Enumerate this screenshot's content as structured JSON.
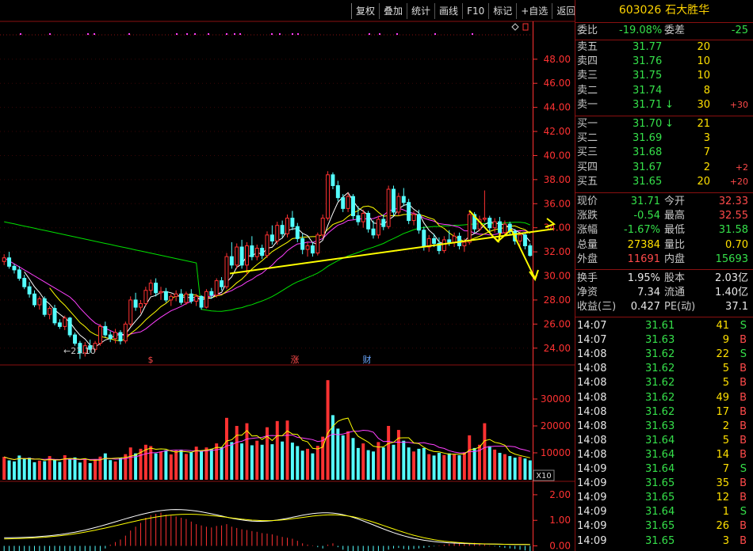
{
  "toolbar": {
    "buttons": [
      "复权",
      "叠加",
      "统计",
      "画线",
      "F10",
      "标记",
      "+自选",
      "返回"
    ]
  },
  "stock": {
    "code": "603026",
    "name": "石大胜华"
  },
  "ratio": {
    "wb_label": "委比",
    "wb_value": "-19.08%",
    "wc_label": "委差",
    "wc_value": "-25"
  },
  "asks": [
    {
      "label": "卖五",
      "price": "31.77",
      "vol": "20",
      "chg": ""
    },
    {
      "label": "卖四",
      "price": "31.76",
      "vol": "10",
      "chg": ""
    },
    {
      "label": "卖三",
      "price": "31.75",
      "vol": "10",
      "chg": ""
    },
    {
      "label": "卖二",
      "price": "31.74",
      "vol": "8",
      "chg": ""
    },
    {
      "label": "卖一",
      "price": "31.71",
      "vol": "30",
      "chg": "+30",
      "arrow": "↓"
    }
  ],
  "bids": [
    {
      "label": "买一",
      "price": "31.70",
      "vol": "21",
      "chg": "",
      "arrow": "↓"
    },
    {
      "label": "买二",
      "price": "31.69",
      "vol": "3",
      "chg": ""
    },
    {
      "label": "买三",
      "price": "31.68",
      "vol": "7",
      "chg": ""
    },
    {
      "label": "买四",
      "price": "31.67",
      "vol": "2",
      "chg": "+2"
    },
    {
      "label": "买五",
      "price": "31.65",
      "vol": "20",
      "chg": "+20"
    }
  ],
  "quote": [
    {
      "l1": "现价",
      "v1": "31.71",
      "c1": "green",
      "l2": "今开",
      "v2": "32.33",
      "c2": "red"
    },
    {
      "l1": "涨跌",
      "v1": "-0.54",
      "c1": "green",
      "l2": "最高",
      "v2": "32.55",
      "c2": "red"
    },
    {
      "l1": "涨幅",
      "v1": "-1.67%",
      "c1": "green",
      "l2": "最低",
      "v2": "31.58",
      "c2": "green"
    },
    {
      "l1": "总量",
      "v1": "27384",
      "c1": "yellow",
      "l2": "量比",
      "v2": "0.70",
      "c2": "yellow"
    },
    {
      "l1": "外盘",
      "v1": "11691",
      "c1": "red",
      "l2": "内盘",
      "v2": "15693",
      "c2": "green"
    }
  ],
  "finance": [
    {
      "l1": "换手",
      "v1": "1.95%",
      "l2": "股本",
      "v2": "2.03亿"
    },
    {
      "l1": "净资",
      "v1": "7.34",
      "l2": "流通",
      "v2": "1.40亿"
    },
    {
      "l1": "收益(三)",
      "v1": "0.427",
      "l2": "PE(动)",
      "v2": "37.1"
    }
  ],
  "ticks": [
    {
      "time": "14:07",
      "price": "31.61",
      "vol": "41",
      "side": "S"
    },
    {
      "time": "14:07",
      "price": "31.63",
      "vol": "9",
      "side": "B"
    },
    {
      "time": "14:08",
      "price": "31.62",
      "vol": "22",
      "side": "S"
    },
    {
      "time": "14:08",
      "price": "31.62",
      "vol": "5",
      "side": "B"
    },
    {
      "time": "14:08",
      "price": "31.62",
      "vol": "5",
      "side": "B"
    },
    {
      "time": "14:08",
      "price": "31.62",
      "vol": "49",
      "side": "B"
    },
    {
      "time": "14:08",
      "price": "31.62",
      "vol": "17",
      "side": "B"
    },
    {
      "time": "14:08",
      "price": "31.63",
      "vol": "2",
      "side": "B"
    },
    {
      "time": "14:08",
      "price": "31.64",
      "vol": "5",
      "side": "B"
    },
    {
      "time": "14:08",
      "price": "31.64",
      "vol": "14",
      "side": "B"
    },
    {
      "time": "14:09",
      "price": "31.64",
      "vol": "7",
      "side": "S"
    },
    {
      "time": "14:09",
      "price": "31.65",
      "vol": "35",
      "side": "B"
    },
    {
      "time": "14:09",
      "price": "31.65",
      "vol": "12",
      "side": "B"
    },
    {
      "time": "14:09",
      "price": "31.64",
      "vol": "1",
      "side": "S"
    },
    {
      "time": "14:09",
      "price": "31.65",
      "vol": "26",
      "side": "B"
    },
    {
      "time": "14:09",
      "price": "31.65",
      "vol": "3",
      "side": "B"
    }
  ],
  "chart": {
    "price_ticks": [
      "48.00",
      "46.00",
      "44.00",
      "42.00",
      "40.00",
      "38.00",
      "36.00",
      "34.00",
      "32.00",
      "30.00",
      "28.00",
      "26.00",
      "24.00"
    ],
    "low_label": "←23.10",
    "markers": [
      "$",
      "涨",
      "财"
    ],
    "volume_ticks": [
      "30000",
      "20000",
      "10000"
    ],
    "volume_unit": "X10",
    "macd_ticks": [
      "2.00",
      "1.00",
      "0.00"
    ],
    "colors": {
      "up": "#ff3232",
      "down": "#54ffff",
      "ma5": "#ffffff",
      "ma10": "#ffff00",
      "ma20": "#ff40ff",
      "ma60": "#00e000",
      "grid": "#8a1010",
      "axis": "#ff3232"
    }
  },
  "chart_data": {
    "type": "candlestick",
    "values": [
      [
        31.2,
        31.8,
        30.9,
        31.5
      ],
      [
        31.5,
        32.0,
        30.6,
        30.8
      ],
      [
        30.8,
        31.0,
        30.2,
        30.5
      ],
      [
        30.5,
        30.8,
        29.6,
        29.8
      ],
      [
        29.8,
        30.1,
        28.9,
        29.1
      ],
      [
        29.1,
        29.5,
        28.2,
        28.5
      ],
      [
        28.5,
        28.8,
        27.4,
        27.6
      ],
      [
        27.6,
        28.3,
        27.2,
        28.1
      ],
      [
        28.1,
        28.3,
        26.6,
        26.8
      ],
      [
        26.8,
        27.5,
        26.4,
        27.3
      ],
      [
        27.3,
        27.6,
        25.9,
        26.1
      ],
      [
        26.1,
        26.4,
        25.6,
        25.8
      ],
      [
        25.8,
        26.7,
        25.5,
        26.5
      ],
      [
        26.5,
        26.6,
        24.9,
        25.1
      ],
      [
        25.1,
        25.3,
        24.2,
        24.4
      ],
      [
        24.4,
        24.6,
        23.1,
        23.6
      ],
      [
        23.6,
        24.5,
        23.3,
        24.2
      ],
      [
        24.2,
        24.7,
        23.6,
        23.9
      ],
      [
        23.9,
        24.6,
        23.7,
        24.4
      ],
      [
        24.4,
        26.0,
        24.2,
        25.8
      ],
      [
        25.8,
        26.2,
        24.9,
        25.1
      ],
      [
        25.1,
        25.4,
        24.5,
        24.8
      ],
      [
        24.8,
        25.6,
        24.4,
        25.3
      ],
      [
        25.3,
        25.5,
        24.3,
        24.6
      ],
      [
        24.6,
        26.2,
        24.4,
        26.0
      ],
      [
        26.0,
        28.3,
        25.8,
        28.0
      ],
      [
        28.0,
        28.6,
        27.1,
        27.4
      ],
      [
        27.4,
        28.0,
        26.9,
        27.7
      ],
      [
        27.7,
        29.1,
        27.5,
        28.8
      ],
      [
        28.8,
        29.7,
        28.4,
        29.4
      ],
      [
        29.4,
        29.8,
        28.3,
        28.6
      ],
      [
        28.6,
        29.1,
        28.0,
        28.7
      ],
      [
        28.7,
        29.0,
        27.8,
        28.0
      ],
      [
        28.0,
        28.5,
        27.5,
        28.3
      ],
      [
        28.3,
        28.8,
        27.9,
        28.5
      ],
      [
        28.5,
        28.9,
        27.6,
        27.8
      ],
      [
        27.8,
        28.7,
        27.6,
        28.5
      ],
      [
        28.5,
        28.9,
        27.7,
        27.9
      ],
      [
        27.9,
        28.5,
        27.5,
        28.3
      ],
      [
        28.3,
        28.4,
        27.2,
        27.4
      ],
      [
        27.4,
        28.9,
        27.3,
        28.7
      ],
      [
        28.7,
        29.0,
        28.1,
        28.4
      ],
      [
        28.4,
        29.8,
        28.2,
        29.6
      ],
      [
        29.6,
        29.9,
        28.8,
        29.1
      ],
      [
        29.1,
        31.9,
        28.9,
        31.6
      ],
      [
        31.6,
        32.8,
        30.6,
        30.9
      ],
      [
        30.9,
        32.7,
        30.6,
        32.4
      ],
      [
        32.4,
        33.0,
        30.6,
        30.9
      ],
      [
        30.9,
        32.8,
        30.1,
        32.5
      ],
      [
        32.5,
        33.3,
        31.3,
        31.6
      ],
      [
        31.6,
        32.6,
        31.3,
        32.3
      ],
      [
        32.3,
        32.6,
        31.4,
        31.7
      ],
      [
        31.7,
        33.7,
        31.5,
        33.4
      ],
      [
        33.4,
        34.2,
        32.6,
        32.9
      ],
      [
        32.9,
        34.5,
        32.6,
        34.2
      ],
      [
        34.2,
        34.6,
        33.2,
        33.5
      ],
      [
        33.5,
        35.1,
        33.2,
        34.8
      ],
      [
        34.8,
        35.4,
        33.8,
        34.1
      ],
      [
        34.1,
        34.4,
        32.8,
        33.1
      ],
      [
        33.1,
        33.5,
        31.8,
        32.2
      ],
      [
        32.2,
        32.8,
        31.6,
        32.5
      ],
      [
        32.5,
        32.8,
        31.6,
        31.9
      ],
      [
        31.9,
        33.6,
        31.7,
        33.4
      ],
      [
        33.4,
        35.1,
        33.1,
        34.8
      ],
      [
        34.8,
        38.7,
        34.6,
        38.4
      ],
      [
        38.4,
        38.6,
        37.2,
        37.5
      ],
      [
        37.5,
        37.9,
        36.2,
        36.5
      ],
      [
        36.5,
        36.8,
        35.3,
        35.6
      ],
      [
        35.6,
        36.9,
        35.3,
        36.6
      ],
      [
        36.6,
        36.8,
        34.7,
        35.0
      ],
      [
        35.0,
        35.8,
        34.2,
        34.5
      ],
      [
        34.5,
        35.5,
        34.0,
        35.2
      ],
      [
        35.2,
        35.4,
        33.6,
        33.9
      ],
      [
        33.9,
        34.6,
        33.1,
        33.4
      ],
      [
        33.4,
        35.0,
        33.1,
        34.7
      ],
      [
        34.7,
        35.1,
        33.8,
        34.1
      ],
      [
        34.1,
        37.5,
        33.9,
        37.2
      ],
      [
        37.2,
        37.5,
        35.0,
        35.3
      ],
      [
        35.3,
        36.9,
        35.0,
        36.6
      ],
      [
        36.6,
        37.3,
        35.8,
        36.1
      ],
      [
        36.1,
        36.4,
        34.3,
        34.6
      ],
      [
        34.6,
        35.4,
        34.2,
        35.1
      ],
      [
        35.1,
        35.5,
        33.5,
        33.8
      ],
      [
        33.8,
        34.1,
        32.1,
        32.4
      ],
      [
        32.4,
        33.4,
        32.0,
        33.1
      ],
      [
        33.1,
        33.5,
        32.4,
        32.7
      ],
      [
        32.7,
        33.2,
        31.8,
        32.1
      ],
      [
        32.1,
        33.3,
        31.9,
        33.0
      ],
      [
        33.0,
        33.8,
        32.5,
        32.8
      ],
      [
        32.8,
        33.6,
        32.4,
        33.3
      ],
      [
        33.3,
        33.6,
        32.2,
        32.5
      ],
      [
        32.5,
        33.1,
        32.0,
        32.8
      ],
      [
        32.8,
        35.4,
        32.6,
        35.1
      ],
      [
        35.1,
        35.3,
        33.6,
        33.9
      ],
      [
        33.9,
        35.0,
        33.7,
        34.7
      ],
      [
        34.7,
        37.1,
        34.5,
        34.8
      ],
      [
        34.8,
        35.0,
        33.7,
        34.0
      ],
      [
        34.0,
        34.8,
        33.6,
        34.5
      ],
      [
        34.5,
        34.9,
        33.3,
        33.6
      ],
      [
        33.6,
        34.6,
        33.4,
        34.3
      ],
      [
        34.3,
        34.5,
        33.4,
        33.7
      ],
      [
        33.7,
        33.9,
        32.6,
        32.9
      ],
      [
        32.9,
        33.7,
        32.5,
        33.4
      ],
      [
        33.4,
        33.6,
        32.2,
        32.5
      ],
      [
        32.5,
        32.7,
        31.6,
        31.7
      ]
    ],
    "volume": [
      8500,
      7200,
      6800,
      9000,
      7800,
      8200,
      6500,
      7100,
      6900,
      8800,
      7400,
      6600,
      9100,
      7700,
      8300,
      6400,
      7900,
      6200,
      7500,
      8600,
      9800,
      7300,
      6800,
      8100,
      9500,
      12000,
      9800,
      11500,
      13000,
      12500,
      9800,
      10500,
      11000,
      9400,
      10800,
      11200,
      9600,
      10200,
      12300,
      10900,
      12000,
      11500,
      13500,
      12100,
      23000,
      14000,
      20000,
      13500,
      21000,
      12800,
      14500,
      13000,
      19500,
      13200,
      21800,
      14200,
      22000,
      13800,
      12500,
      10800,
      11500,
      9800,
      12600,
      16000,
      37000,
      24000,
      19000,
      16500,
      18000,
      15500,
      11800,
      13500,
      11000,
      10500,
      14000,
      12000,
      20000,
      13000,
      18500,
      14500,
      12000,
      10500,
      11500,
      11800,
      9500,
      9000,
      10000,
      9200,
      9800,
      9500,
      9100,
      10200,
      16500,
      11800,
      13000,
      21000,
      12500,
      11200,
      10000,
      9500,
      8800,
      8200,
      8600,
      7900,
      7200
    ],
    "macd": [
      -0.3,
      -0.25,
      -0.35,
      -0.4,
      -0.32,
      -0.38,
      -0.45,
      -0.4,
      -0.5,
      -0.48,
      -0.55,
      -0.5,
      -0.45,
      -0.52,
      -0.58,
      -0.55,
      -0.45,
      -0.38,
      -0.3,
      -0.2,
      -0.1,
      0.05,
      0.15,
      0.25,
      0.4,
      0.6,
      0.75,
      0.9,
      1.1,
      1.2,
      1.25,
      1.3,
      1.22,
      1.18,
      1.15,
      1.1,
      1.05,
      0.95,
      0.85,
      0.8,
      0.75,
      0.72,
      0.78,
      0.8,
      0.85,
      0.75,
      0.7,
      0.65,
      0.62,
      0.58,
      0.55,
      0.5,
      0.48,
      0.45,
      0.4,
      0.35,
      0.32,
      0.28,
      0.2,
      0.1,
      0.05,
      0.02,
      -0.05,
      -0.1,
      0.05,
      0.1,
      -0.05,
      -0.15,
      -0.25,
      -0.32,
      -0.38,
      -0.4,
      -0.42,
      -0.35,
      -0.28,
      -0.2,
      -0.15,
      -0.1,
      -0.08,
      -0.12,
      -0.15,
      -0.12,
      -0.1,
      -0.08,
      -0.05,
      -0.02,
      0.02,
      0.05,
      0.08,
      0.1,
      0.12,
      0.1,
      0.08,
      0.12,
      0.1,
      0.06,
      0.02,
      -0.02,
      -0.05,
      -0.08,
      -0.1,
      -0.12,
      -0.15,
      -0.18,
      -0.2
    ],
    "ylim": [
      22.8,
      49.5
    ],
    "volume_lim": [
      0,
      40000
    ],
    "macd_lim": [
      -0.2,
      2.4
    ]
  }
}
